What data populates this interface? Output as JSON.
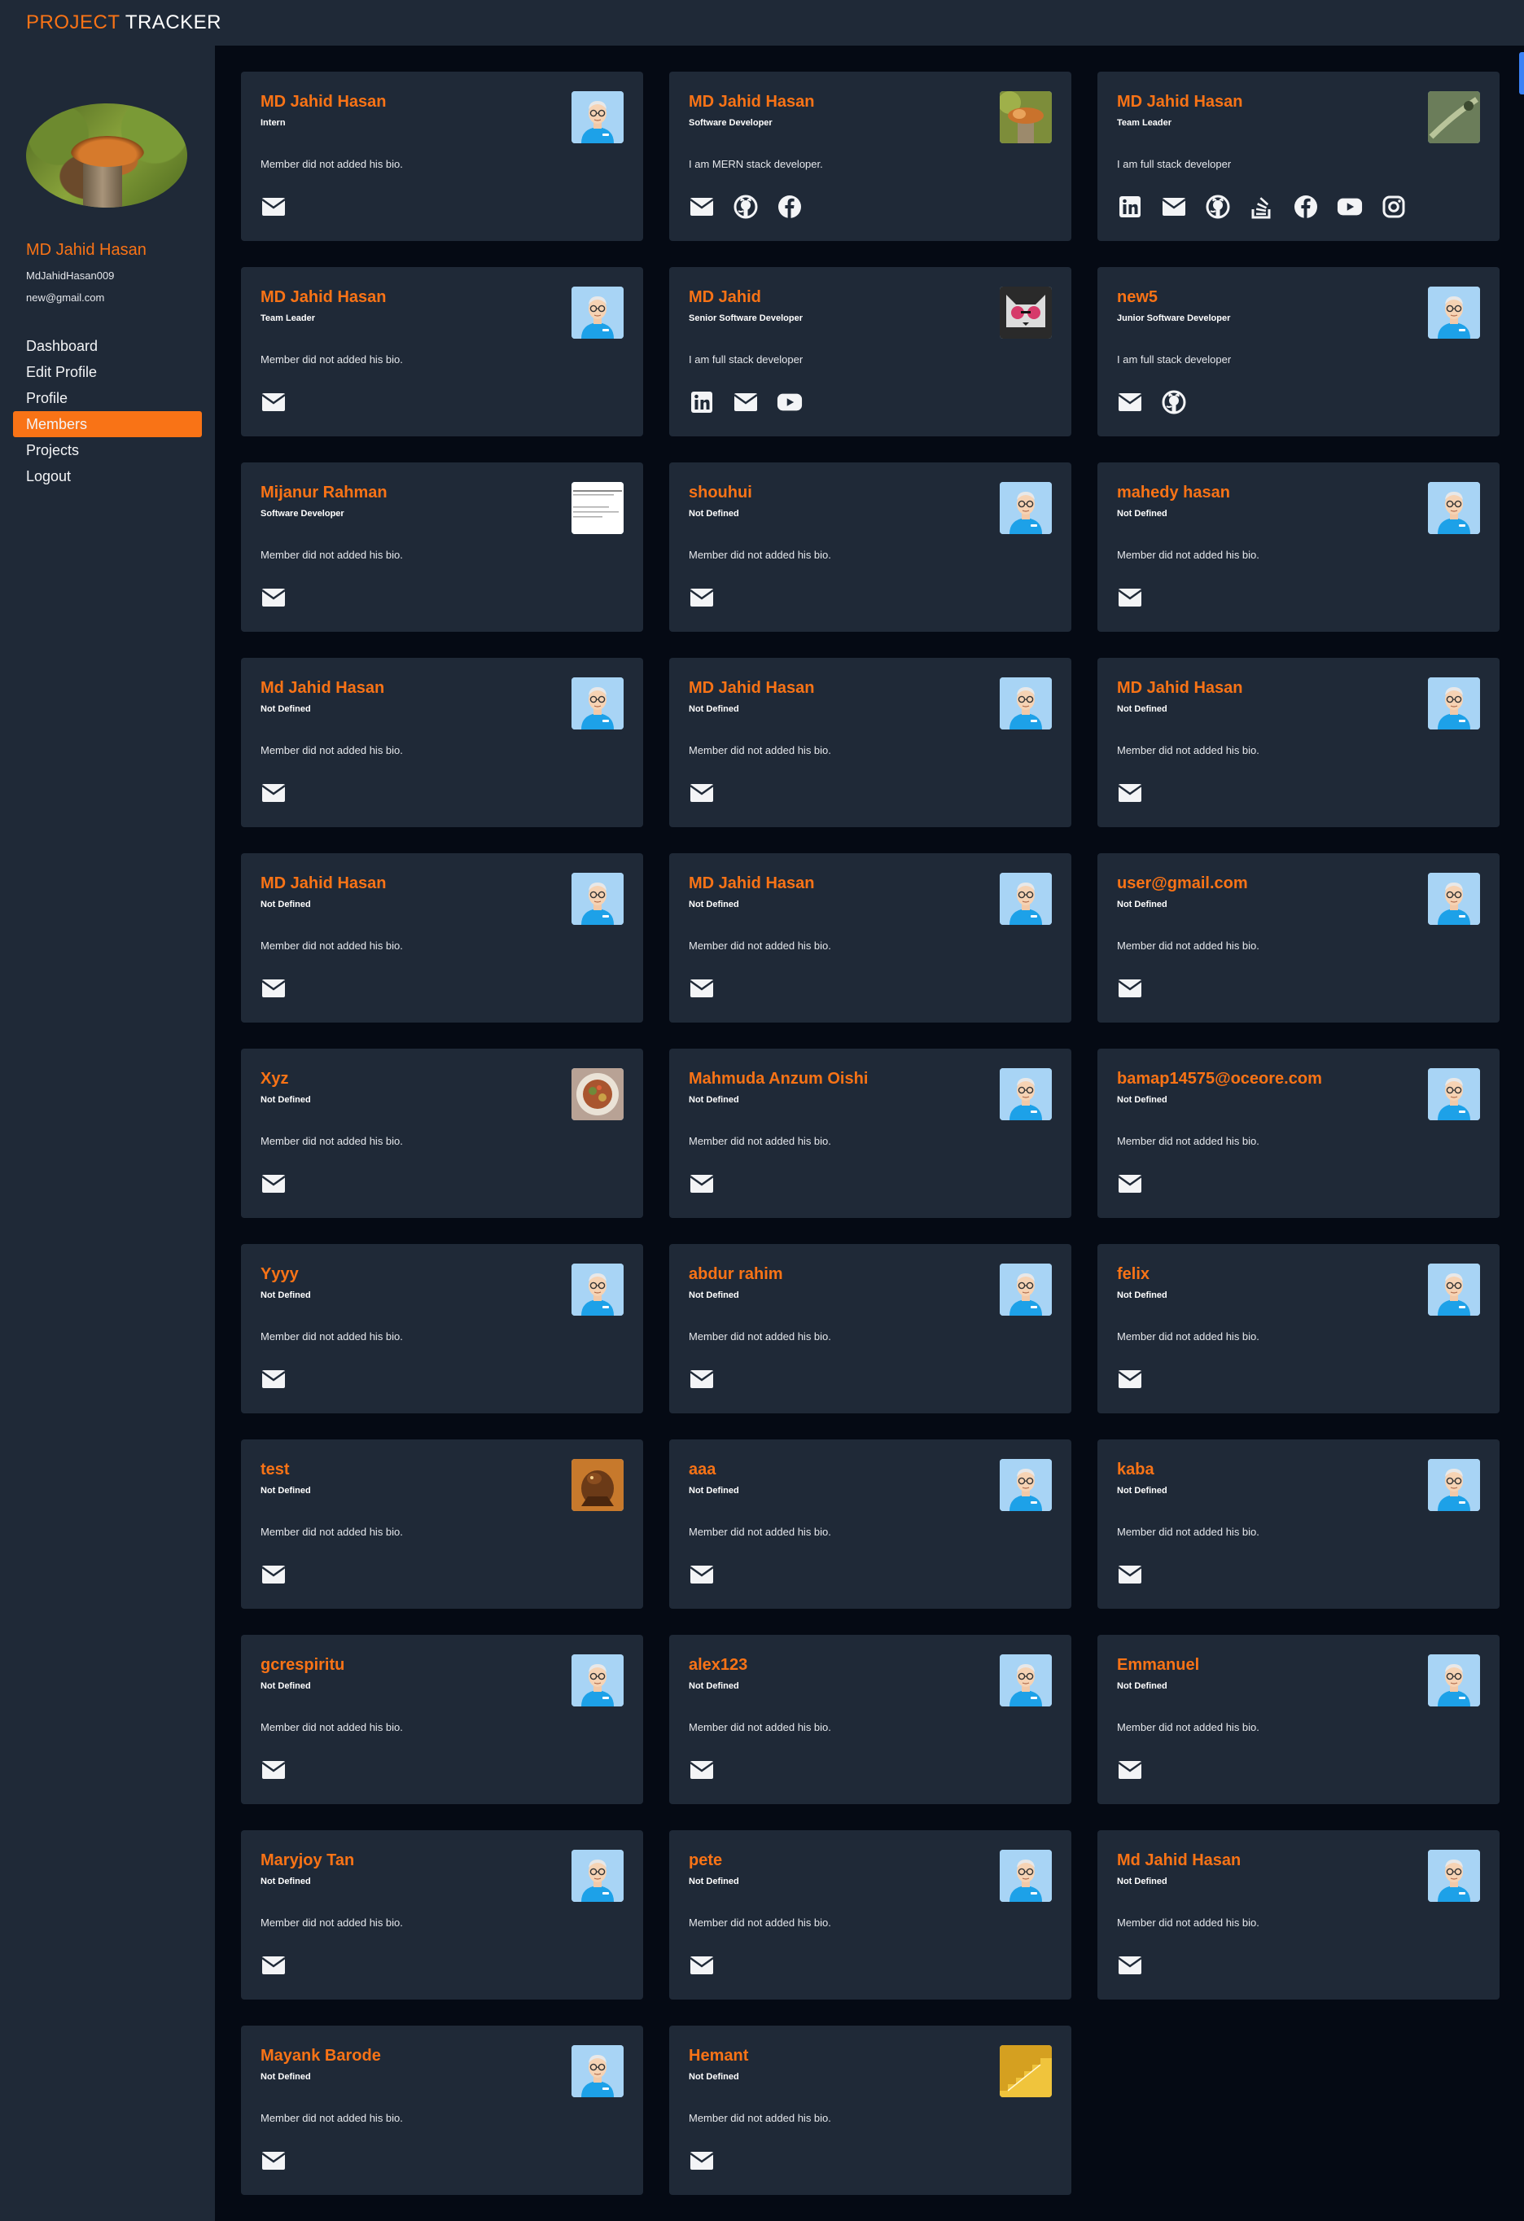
{
  "app": {
    "brand_accent": "PROJECT",
    "brand_rest": "TRACKER"
  },
  "colors": {
    "accent": "#f97316",
    "panel": "#1f2937",
    "background": "#050a14"
  },
  "user": {
    "name": "MD Jahid Hasan",
    "username": "MdJahidHasan009",
    "email": "new@gmail.com"
  },
  "nav": [
    {
      "label": "Dashboard",
      "active": false
    },
    {
      "label": "Edit Profile",
      "active": false
    },
    {
      "label": "Profile",
      "active": false
    },
    {
      "label": "Members",
      "active": true
    },
    {
      "label": "Projects",
      "active": false
    },
    {
      "label": "Logout",
      "active": false
    }
  ],
  "members": [
    {
      "name": "MD Jahid Hasan",
      "role": "Intern",
      "bio": "Member did not added his bio.",
      "avatar": "default",
      "socials": [
        "envelope-icon"
      ]
    },
    {
      "name": "MD Jahid Hasan",
      "role": "Software Developer",
      "bio": "I am MERN stack developer.",
      "avatar": "fox",
      "socials": [
        "envelope-icon",
        "github-icon",
        "facebook-icon"
      ]
    },
    {
      "name": "MD Jahid Hasan",
      "role": "Team Leader",
      "bio": "I am full stack developer",
      "avatar": "lizard",
      "socials": [
        "linkedin-icon",
        "envelope-icon",
        "github-icon",
        "stackoverflow-icon",
        "facebook-icon",
        "youtube-icon",
        "instagram-icon"
      ]
    },
    {
      "name": "MD Jahid Hasan",
      "role": "Team Leader",
      "bio": "Member did not added his bio.",
      "avatar": "default",
      "socials": [
        "envelope-icon"
      ]
    },
    {
      "name": "MD Jahid",
      "role": "Senior Software Developer",
      "bio": "I am full stack developer",
      "avatar": "cat",
      "socials": [
        "linkedin-icon",
        "envelope-icon",
        "youtube-icon"
      ]
    },
    {
      "name": "new5",
      "role": "Junior Software Developer",
      "bio": "I am full stack developer",
      "avatar": "default",
      "socials": [
        "envelope-icon",
        "github-icon"
      ]
    },
    {
      "name": "Mijanur Rahman",
      "role": "Software Developer",
      "bio": "Member did not added his bio.",
      "avatar": "document",
      "socials": [
        "envelope-icon"
      ]
    },
    {
      "name": "shouhui",
      "role": "Not Defined",
      "bio": "Member did not added his bio.",
      "avatar": "default",
      "socials": [
        "envelope-icon"
      ]
    },
    {
      "name": "mahedy hasan",
      "role": "Not Defined",
      "bio": "Member did not added his bio.",
      "avatar": "default",
      "socials": [
        "envelope-icon"
      ]
    },
    {
      "name": "Md Jahid Hasan",
      "role": "Not Defined",
      "bio": "Member did not added his bio.",
      "avatar": "default",
      "socials": [
        "envelope-icon"
      ]
    },
    {
      "name": "MD Jahid Hasan",
      "role": "Not Defined",
      "bio": "Member did not added his bio.",
      "avatar": "default",
      "socials": [
        "envelope-icon"
      ]
    },
    {
      "name": "MD Jahid Hasan",
      "role": "Not Defined",
      "bio": "Member did not added his bio.",
      "avatar": "default",
      "socials": [
        "envelope-icon"
      ]
    },
    {
      "name": "MD Jahid Hasan",
      "role": "Not Defined",
      "bio": "Member did not added his bio.",
      "avatar": "default",
      "socials": [
        "envelope-icon"
      ]
    },
    {
      "name": "MD Jahid Hasan",
      "role": "Not Defined",
      "bio": "Member did not added his bio.",
      "avatar": "default",
      "socials": [
        "envelope-icon"
      ]
    },
    {
      "name": "user@gmail.com",
      "role": "Not Defined",
      "bio": "Member did not added his bio.",
      "avatar": "default",
      "socials": [
        "envelope-icon"
      ]
    },
    {
      "name": "Xyz",
      "role": "Not Defined",
      "bio": "Member did not added his bio.",
      "avatar": "food",
      "socials": [
        "envelope-icon"
      ]
    },
    {
      "name": "Mahmuda Anzum Oishi",
      "role": "Not Defined",
      "bio": "Member did not added his bio.",
      "avatar": "default",
      "socials": [
        "envelope-icon"
      ]
    },
    {
      "name": "bamap14575@oceore.com",
      "role": "Not Defined",
      "bio": "Member did not added his bio.",
      "avatar": "default",
      "socials": [
        "envelope-icon"
      ]
    },
    {
      "name": "Yyyy",
      "role": "Not Defined",
      "bio": "Member did not added his bio.",
      "avatar": "default",
      "socials": [
        "envelope-icon"
      ]
    },
    {
      "name": "abdur rahim",
      "role": "Not Defined",
      "bio": "Member did not added his bio.",
      "avatar": "default",
      "socials": [
        "envelope-icon"
      ]
    },
    {
      "name": "felix",
      "role": "Not Defined",
      "bio": "Member did not added his bio.",
      "avatar": "default",
      "socials": [
        "envelope-icon"
      ]
    },
    {
      "name": "test",
      "role": "Not Defined",
      "bio": "Member did not added his bio.",
      "avatar": "creature",
      "socials": [
        "envelope-icon"
      ]
    },
    {
      "name": "aaa",
      "role": "Not Defined",
      "bio": "Member did not added his bio.",
      "avatar": "default",
      "socials": [
        "envelope-icon"
      ]
    },
    {
      "name": "kaba",
      "role": "Not Defined",
      "bio": "Member did not added his bio.",
      "avatar": "default",
      "socials": [
        "envelope-icon"
      ]
    },
    {
      "name": "gcrespiritu",
      "role": "Not Defined",
      "bio": "Member did not added his bio.",
      "avatar": "default",
      "socials": [
        "envelope-icon"
      ]
    },
    {
      "name": "alex123",
      "role": "Not Defined",
      "bio": "Member did not added his bio.",
      "avatar": "default",
      "socials": [
        "envelope-icon"
      ]
    },
    {
      "name": "Emmanuel",
      "role": "Not Defined",
      "bio": "Member did not added his bio.",
      "avatar": "default",
      "socials": [
        "envelope-icon"
      ]
    },
    {
      "name": "Maryjoy Tan",
      "role": "Not Defined",
      "bio": "Member did not added his bio.",
      "avatar": "default",
      "socials": [
        "envelope-icon"
      ]
    },
    {
      "name": "pete",
      "role": "Not Defined",
      "bio": "Member did not added his bio.",
      "avatar": "default",
      "socials": [
        "envelope-icon"
      ]
    },
    {
      "name": "Md Jahid Hasan",
      "role": "Not Defined",
      "bio": "Member did not added his bio.",
      "avatar": "default",
      "socials": [
        "envelope-icon"
      ]
    },
    {
      "name": "Mayank Barode",
      "role": "Not Defined",
      "bio": "Member did not added his bio.",
      "avatar": "default",
      "socials": [
        "envelope-icon"
      ]
    },
    {
      "name": "Hemant",
      "role": "Not Defined",
      "bio": "Member did not added his bio.",
      "avatar": "stairs",
      "socials": [
        "envelope-icon"
      ]
    }
  ]
}
